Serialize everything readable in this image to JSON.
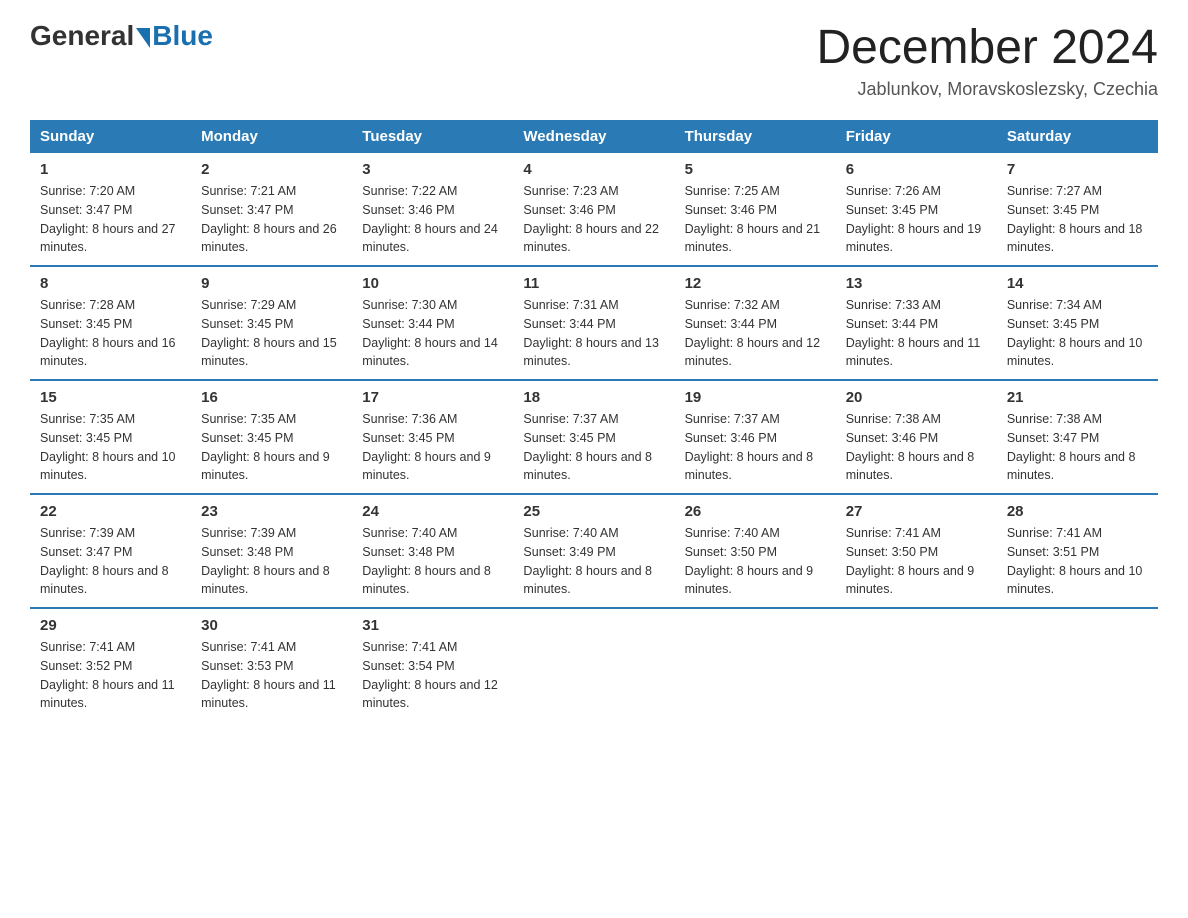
{
  "header": {
    "logo_general": "General",
    "logo_blue": "Blue",
    "month_title": "December 2024",
    "location": "Jablunkov, Moravskoslezsky, Czechia"
  },
  "days_of_week": [
    "Sunday",
    "Monday",
    "Tuesday",
    "Wednesday",
    "Thursday",
    "Friday",
    "Saturday"
  ],
  "weeks": [
    [
      {
        "day": "1",
        "sunrise": "7:20 AM",
        "sunset": "3:47 PM",
        "daylight": "8 hours and 27 minutes."
      },
      {
        "day": "2",
        "sunrise": "7:21 AM",
        "sunset": "3:47 PM",
        "daylight": "8 hours and 26 minutes."
      },
      {
        "day": "3",
        "sunrise": "7:22 AM",
        "sunset": "3:46 PM",
        "daylight": "8 hours and 24 minutes."
      },
      {
        "day": "4",
        "sunrise": "7:23 AM",
        "sunset": "3:46 PM",
        "daylight": "8 hours and 22 minutes."
      },
      {
        "day": "5",
        "sunrise": "7:25 AM",
        "sunset": "3:46 PM",
        "daylight": "8 hours and 21 minutes."
      },
      {
        "day": "6",
        "sunrise": "7:26 AM",
        "sunset": "3:45 PM",
        "daylight": "8 hours and 19 minutes."
      },
      {
        "day": "7",
        "sunrise": "7:27 AM",
        "sunset": "3:45 PM",
        "daylight": "8 hours and 18 minutes."
      }
    ],
    [
      {
        "day": "8",
        "sunrise": "7:28 AM",
        "sunset": "3:45 PM",
        "daylight": "8 hours and 16 minutes."
      },
      {
        "day": "9",
        "sunrise": "7:29 AM",
        "sunset": "3:45 PM",
        "daylight": "8 hours and 15 minutes."
      },
      {
        "day": "10",
        "sunrise": "7:30 AM",
        "sunset": "3:44 PM",
        "daylight": "8 hours and 14 minutes."
      },
      {
        "day": "11",
        "sunrise": "7:31 AM",
        "sunset": "3:44 PM",
        "daylight": "8 hours and 13 minutes."
      },
      {
        "day": "12",
        "sunrise": "7:32 AM",
        "sunset": "3:44 PM",
        "daylight": "8 hours and 12 minutes."
      },
      {
        "day": "13",
        "sunrise": "7:33 AM",
        "sunset": "3:44 PM",
        "daylight": "8 hours and 11 minutes."
      },
      {
        "day": "14",
        "sunrise": "7:34 AM",
        "sunset": "3:45 PM",
        "daylight": "8 hours and 10 minutes."
      }
    ],
    [
      {
        "day": "15",
        "sunrise": "7:35 AM",
        "sunset": "3:45 PM",
        "daylight": "8 hours and 10 minutes."
      },
      {
        "day": "16",
        "sunrise": "7:35 AM",
        "sunset": "3:45 PM",
        "daylight": "8 hours and 9 minutes."
      },
      {
        "day": "17",
        "sunrise": "7:36 AM",
        "sunset": "3:45 PM",
        "daylight": "8 hours and 9 minutes."
      },
      {
        "day": "18",
        "sunrise": "7:37 AM",
        "sunset": "3:45 PM",
        "daylight": "8 hours and 8 minutes."
      },
      {
        "day": "19",
        "sunrise": "7:37 AM",
        "sunset": "3:46 PM",
        "daylight": "8 hours and 8 minutes."
      },
      {
        "day": "20",
        "sunrise": "7:38 AM",
        "sunset": "3:46 PM",
        "daylight": "8 hours and 8 minutes."
      },
      {
        "day": "21",
        "sunrise": "7:38 AM",
        "sunset": "3:47 PM",
        "daylight": "8 hours and 8 minutes."
      }
    ],
    [
      {
        "day": "22",
        "sunrise": "7:39 AM",
        "sunset": "3:47 PM",
        "daylight": "8 hours and 8 minutes."
      },
      {
        "day": "23",
        "sunrise": "7:39 AM",
        "sunset": "3:48 PM",
        "daylight": "8 hours and 8 minutes."
      },
      {
        "day": "24",
        "sunrise": "7:40 AM",
        "sunset": "3:48 PM",
        "daylight": "8 hours and 8 minutes."
      },
      {
        "day": "25",
        "sunrise": "7:40 AM",
        "sunset": "3:49 PM",
        "daylight": "8 hours and 8 minutes."
      },
      {
        "day": "26",
        "sunrise": "7:40 AM",
        "sunset": "3:50 PM",
        "daylight": "8 hours and 9 minutes."
      },
      {
        "day": "27",
        "sunrise": "7:41 AM",
        "sunset": "3:50 PM",
        "daylight": "8 hours and 9 minutes."
      },
      {
        "day": "28",
        "sunrise": "7:41 AM",
        "sunset": "3:51 PM",
        "daylight": "8 hours and 10 minutes."
      }
    ],
    [
      {
        "day": "29",
        "sunrise": "7:41 AM",
        "sunset": "3:52 PM",
        "daylight": "8 hours and 11 minutes."
      },
      {
        "day": "30",
        "sunrise": "7:41 AM",
        "sunset": "3:53 PM",
        "daylight": "8 hours and 11 minutes."
      },
      {
        "day": "31",
        "sunrise": "7:41 AM",
        "sunset": "3:54 PM",
        "daylight": "8 hours and 12 minutes."
      },
      null,
      null,
      null,
      null
    ]
  ]
}
